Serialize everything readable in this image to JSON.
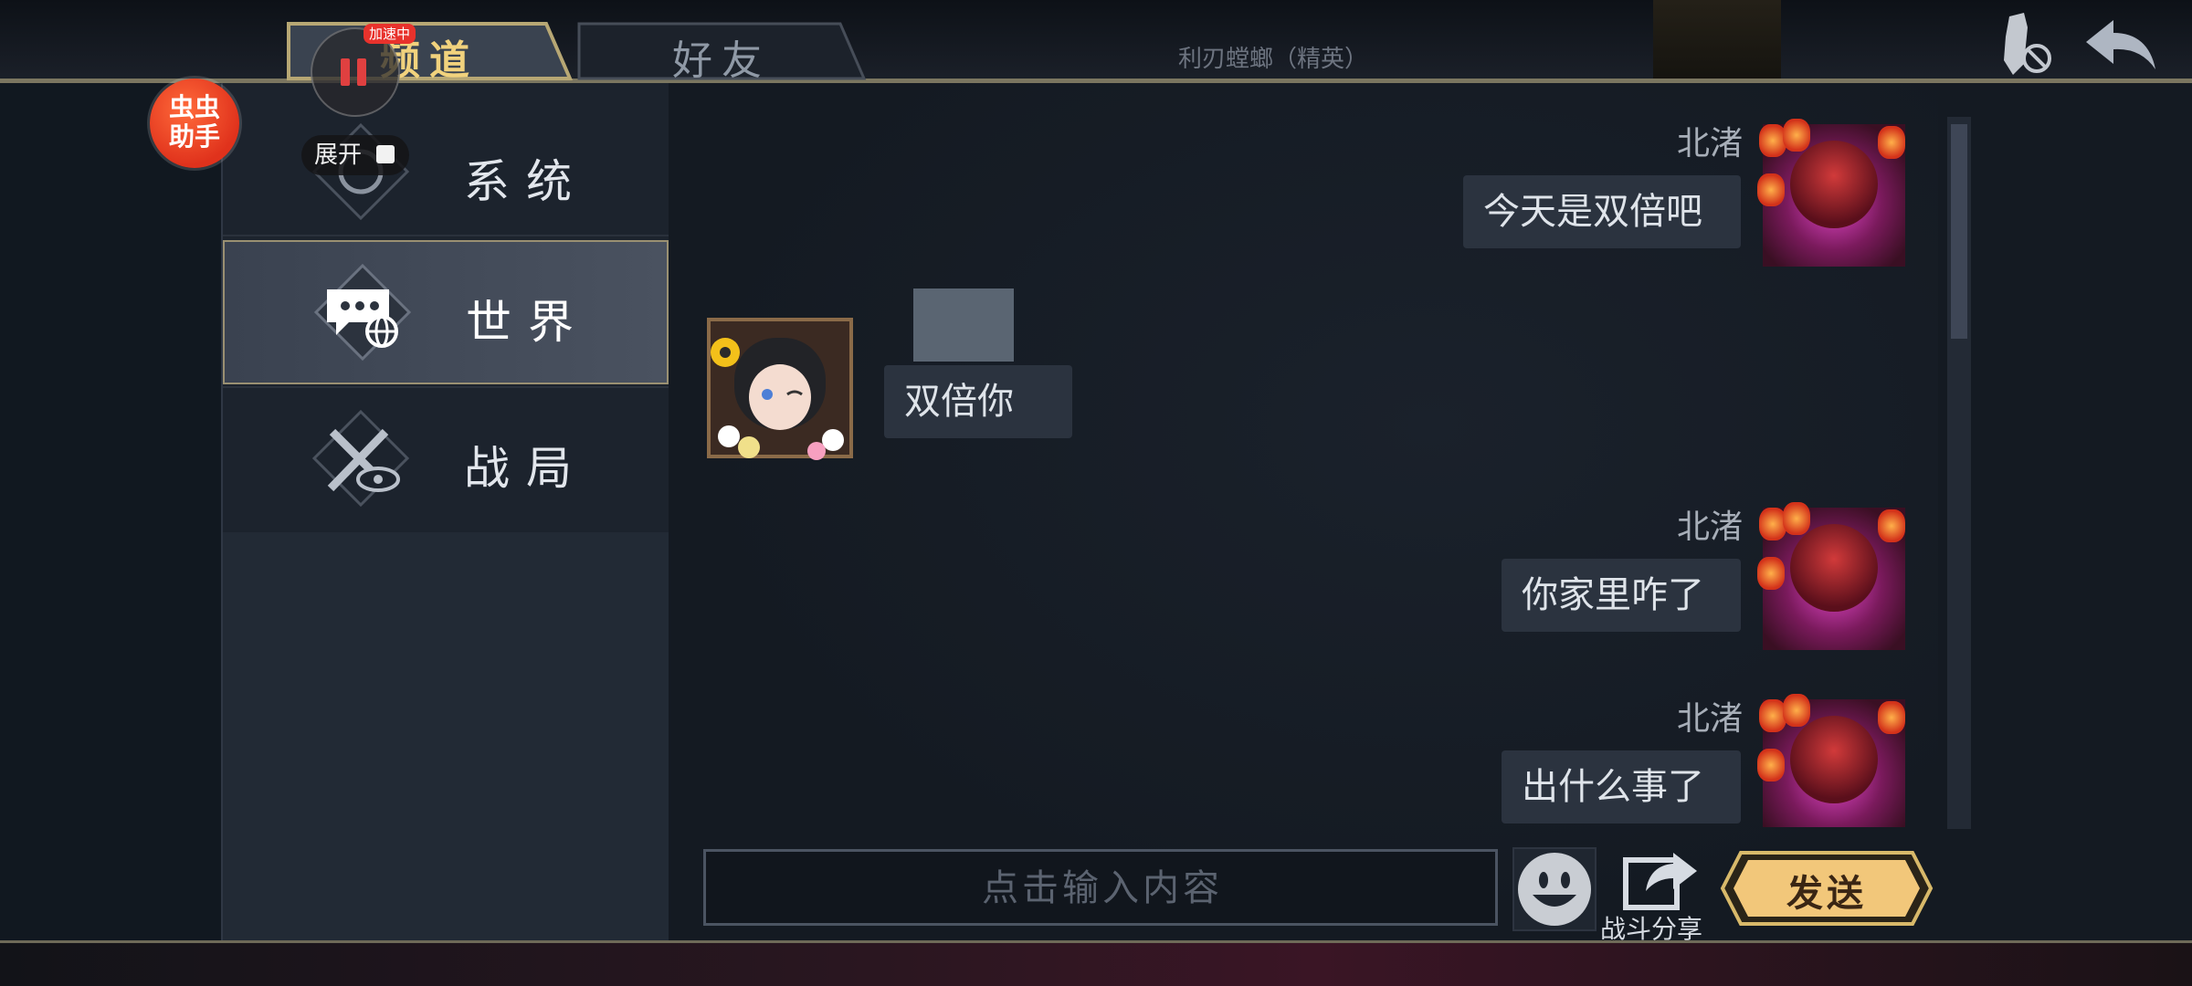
{
  "tabs": {
    "channel": "频道",
    "friends": "好友"
  },
  "boss_label": "利刃螳螂（精英）",
  "sidebar": {
    "items": [
      {
        "label": "系统",
        "icon": "system-icon"
      },
      {
        "label": "世界",
        "icon": "world-chat-icon",
        "active": true
      },
      {
        "label": "战局",
        "icon": "battle-watch-icon"
      }
    ]
  },
  "messages": [
    {
      "side": "right",
      "name": "北渚",
      "text": "今天是双倍吧"
    },
    {
      "side": "left",
      "name": "",
      "text": "双倍你"
    },
    {
      "side": "right",
      "name": "北渚",
      "text": "你家里咋了"
    },
    {
      "side": "right",
      "name": "北渚",
      "text": "出什么事了"
    }
  ],
  "input": {
    "placeholder": "点击输入内容",
    "value": ""
  },
  "share_label": "战斗分享",
  "send_label": "发送",
  "overlay": {
    "accel_badge": "加速中",
    "expand_label": "展开",
    "helper_label": "虫虫助手"
  },
  "colors": {
    "gold": "#f1d27d",
    "send_button": "#f2c77a",
    "helper": "#e0321c"
  }
}
